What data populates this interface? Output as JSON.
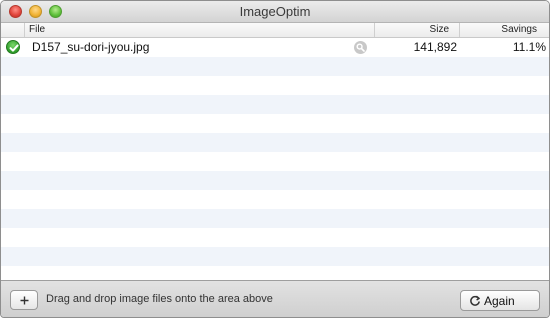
{
  "window": {
    "title": "ImageOptim"
  },
  "columns": {
    "file": "File",
    "size": "Size",
    "savings": "Savings"
  },
  "files": [
    {
      "name": "D157_su-dori-jyou.jpg",
      "size": "141,892",
      "savings": "11.1%",
      "status": "success",
      "status_icon": "check-circle-icon",
      "reveal_icon": "magnifier-icon"
    }
  ],
  "footer": {
    "add_icon": "plus-icon",
    "hint": "Drag and drop image files onto the area above",
    "again_label": "Again",
    "again_icon": "refresh-icon"
  },
  "colors": {
    "success": "#2e9c2a",
    "row_alt": "#f0f4fa"
  }
}
